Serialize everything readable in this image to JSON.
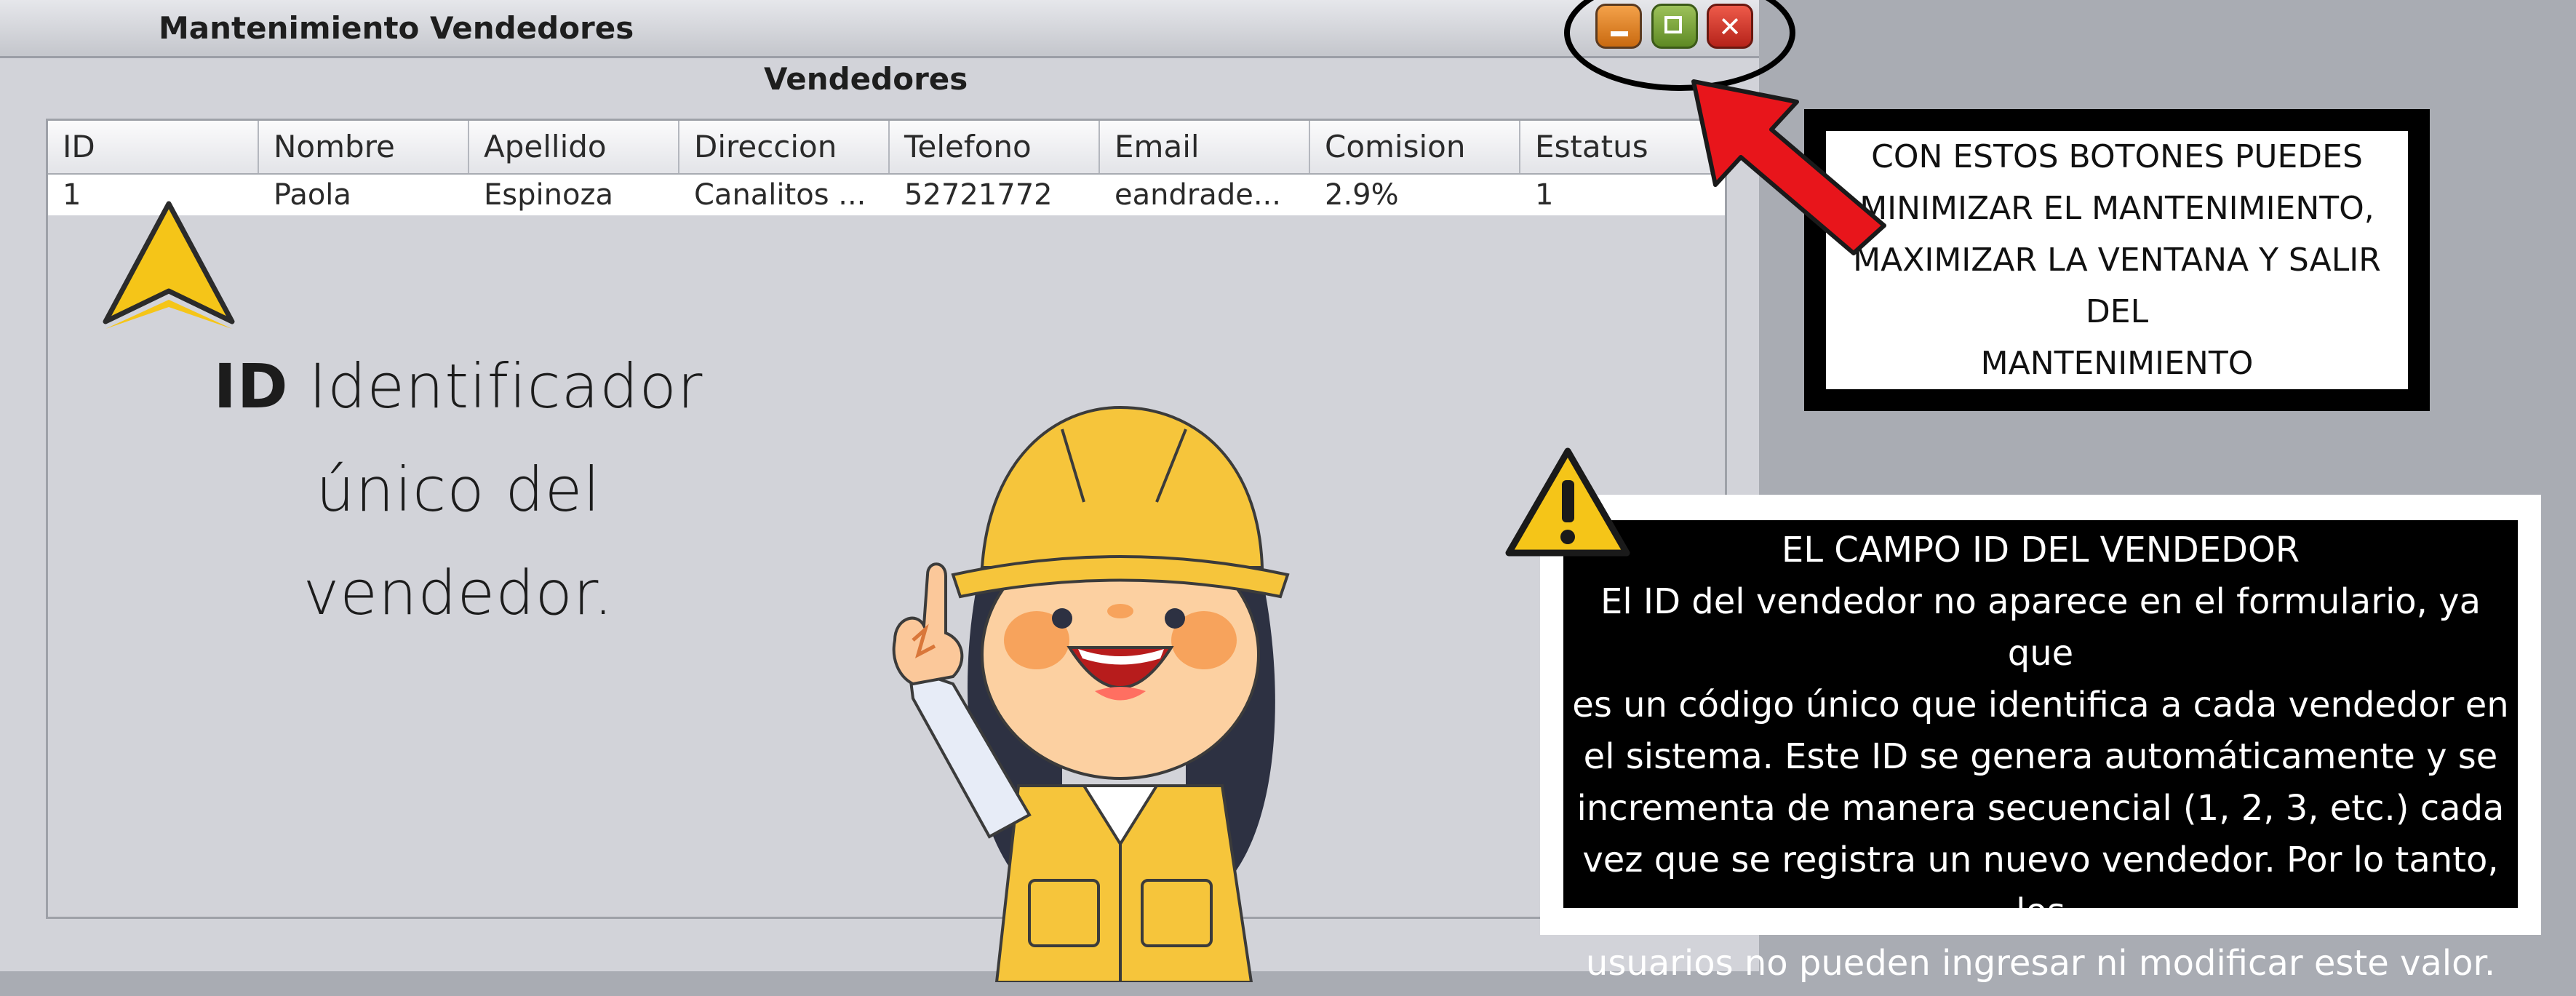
{
  "window": {
    "title": "Mantenimiento Vendedores",
    "controls": {
      "minimize": "minimize-button",
      "maximize": "maximize-button",
      "close": "close-button"
    }
  },
  "table": {
    "caption": "Vendedores",
    "columns": [
      "ID",
      "Nombre",
      "Apellido",
      "Direccion",
      "Telefono",
      "Email",
      "Comision",
      "Estatus"
    ],
    "rows": [
      [
        "1",
        "Paola",
        "Espinoza",
        "Canalitos ...",
        "52721772",
        "eandrade...",
        "2.9%",
        "1"
      ]
    ]
  },
  "id_note": {
    "bold": "ID",
    "line1": "Identificador único del",
    "line2": "vendedor."
  },
  "callout_buttons": {
    "lines": [
      "CON ESTOS BOTONES PUEDES",
      "MINIMIZAR EL MANTENIMIENTO,",
      "MAXIMIZAR LA VENTANA Y SALIR DEL",
      "MANTENIMIENTO"
    ]
  },
  "info_box": {
    "title": "EL CAMPO ID DEL VENDEDOR",
    "lines": [
      "El ID del vendedor no aparece en el formulario, ya que",
      "es un código único que identifica a cada vendedor en",
      "el sistema. Este ID se genera automáticamente y se",
      "incrementa de manera secuencial (1, 2, 3, etc.) cada",
      "vez que se registra un nuevo vendedor. Por lo tanto, los",
      "usuarios no pueden ingresar ni modificar este valor."
    ]
  },
  "colors": {
    "window_bg": "#d2d3d9",
    "arrow_yellow": "#f5c518",
    "arrow_red": "#e8151b"
  }
}
